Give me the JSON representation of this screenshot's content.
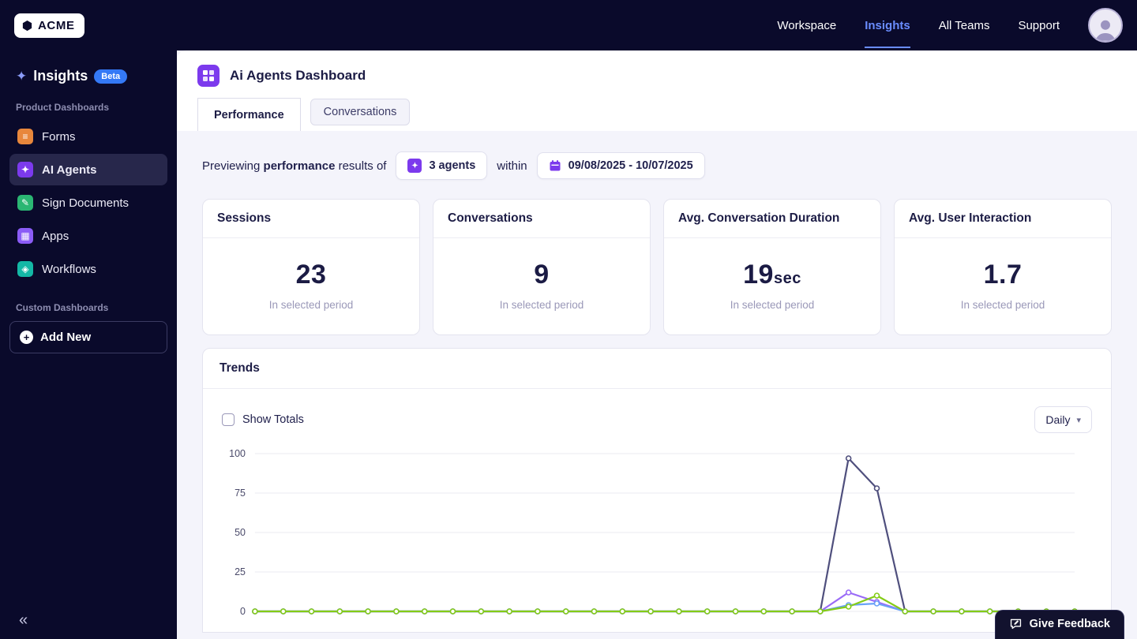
{
  "topbar": {
    "brand": "ACME",
    "nav": [
      {
        "label": "Workspace",
        "active": false
      },
      {
        "label": "Insights",
        "active": true
      },
      {
        "label": "All Teams",
        "active": false
      },
      {
        "label": "Support",
        "active": false
      }
    ]
  },
  "sidebar": {
    "title": "Insights",
    "beta_badge": "Beta",
    "sections": [
      {
        "label": "Product Dashboards",
        "items": [
          {
            "label": "Forms",
            "color": "#e8873c",
            "active": false
          },
          {
            "label": "AI Agents",
            "color": "#7c3aed",
            "active": true
          },
          {
            "label": "Sign Documents",
            "color": "#2bb673",
            "active": false
          },
          {
            "label": "Apps",
            "color": "#8b5cf6",
            "active": false
          },
          {
            "label": "Workflows",
            "color": "#14b8a6",
            "active": false
          }
        ]
      },
      {
        "label": "Custom Dashboards",
        "items": []
      }
    ],
    "add_new_label": "Add New"
  },
  "header": {
    "title": "Ai Agents Dashboard",
    "tabs": [
      {
        "label": "Performance",
        "active": true
      },
      {
        "label": "Conversations",
        "active": false
      }
    ]
  },
  "filters": {
    "preview_prefix": "Previewing",
    "preview_bold": "performance",
    "preview_suffix": "results of",
    "agents_button": "3 agents",
    "within_label": "within",
    "date_range": "09/08/2025 - 10/07/2025"
  },
  "stats": [
    {
      "title": "Sessions",
      "value": "23",
      "unit": "",
      "caption": "In selected period"
    },
    {
      "title": "Conversations",
      "value": "9",
      "unit": "",
      "caption": "In selected period"
    },
    {
      "title": "Avg. Conversation Duration",
      "value": "19",
      "unit": "sec",
      "caption": "In selected period"
    },
    {
      "title": "Avg. User Interaction",
      "value": "1.7",
      "unit": "",
      "caption": "In selected period"
    }
  ],
  "trends": {
    "title": "Trends",
    "show_totals_label": "Show Totals",
    "show_totals_checked": false,
    "interval_label": "Daily"
  },
  "feedback_button": "Give Feedback",
  "chart_data": {
    "type": "line",
    "x_count": 30,
    "x_range_label": "09/08/2025 - 10/07/2025",
    "ylim": [
      0,
      100
    ],
    "yticks": [
      0,
      25,
      50,
      75,
      100
    ],
    "grid": true,
    "legend_visible": false,
    "series": [
      {
        "name": "series-1",
        "color": "#4f4f7d",
        "values": [
          0,
          0,
          0,
          0,
          0,
          0,
          0,
          0,
          0,
          0,
          0,
          0,
          0,
          0,
          0,
          0,
          0,
          0,
          0,
          0,
          0,
          97,
          78,
          0,
          0,
          0,
          0,
          0,
          0,
          0
        ]
      },
      {
        "name": "series-2",
        "color": "#9a6bf7",
        "values": [
          0,
          0,
          0,
          0,
          0,
          0,
          0,
          0,
          0,
          0,
          0,
          0,
          0,
          0,
          0,
          0,
          0,
          0,
          0,
          0,
          0,
          12,
          6,
          0,
          0,
          0,
          0,
          0,
          0,
          0
        ]
      },
      {
        "name": "series-3",
        "color": "#6aa2f7",
        "values": [
          0,
          0,
          0,
          0,
          0,
          0,
          0,
          0,
          0,
          0,
          0,
          0,
          0,
          0,
          0,
          0,
          0,
          0,
          0,
          0,
          0,
          4,
          5,
          0,
          0,
          0,
          0,
          0,
          0,
          0
        ]
      },
      {
        "name": "series-4",
        "color": "#84cc16",
        "values": [
          0,
          0,
          0,
          0,
          0,
          0,
          0,
          0,
          0,
          0,
          0,
          0,
          0,
          0,
          0,
          0,
          0,
          0,
          0,
          0,
          0,
          3,
          10,
          0,
          0,
          0,
          0,
          0,
          0,
          0
        ]
      }
    ]
  }
}
